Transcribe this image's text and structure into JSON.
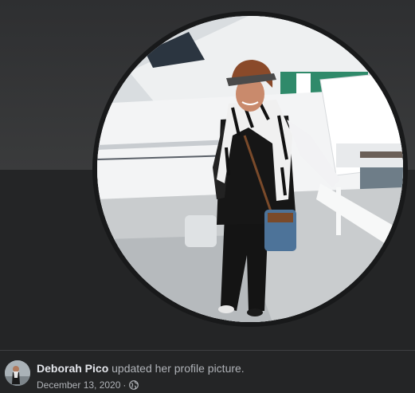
{
  "post": {
    "author_name": "Deborah Pico",
    "action_text": " updated her profile picture.",
    "date": "December 13, 2020",
    "separator": "·",
    "audience_icon": "globe-icon"
  },
  "photo": {
    "subject": "profile-picture"
  },
  "colors": {
    "background": "#242526",
    "cover_top": "#3a3b3c",
    "author_text": "#e4e6eb",
    "secondary_text": "#b0b3b8",
    "photo_border": "#18191a"
  }
}
